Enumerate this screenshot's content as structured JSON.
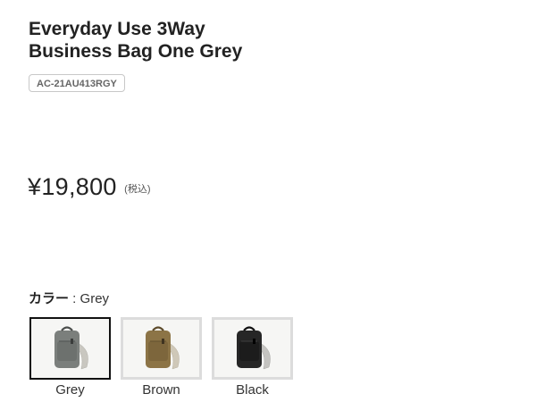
{
  "product": {
    "title_line1": "Everyday Use 3Way",
    "title_line2": "Business Bag One Grey",
    "sku": "AC-21AU413RGY",
    "price": "¥19,800",
    "tax_note": "(税込)"
  },
  "color_selector": {
    "label": "カラー",
    "separator": " : ",
    "selected": "Grey",
    "options": [
      {
        "name": "Grey",
        "icon": "backpack-grey-image",
        "color": "#7b7f7c",
        "selected": true
      },
      {
        "name": "Brown",
        "icon": "backpack-brown-image",
        "color": "#8c7446",
        "selected": false
      },
      {
        "name": "Black",
        "icon": "backpack-black-image",
        "color": "#262626",
        "selected": false
      }
    ]
  },
  "colors": {
    "text": "#222222",
    "selected_border": "#111111",
    "unselected_border": "#dcdcdc"
  }
}
